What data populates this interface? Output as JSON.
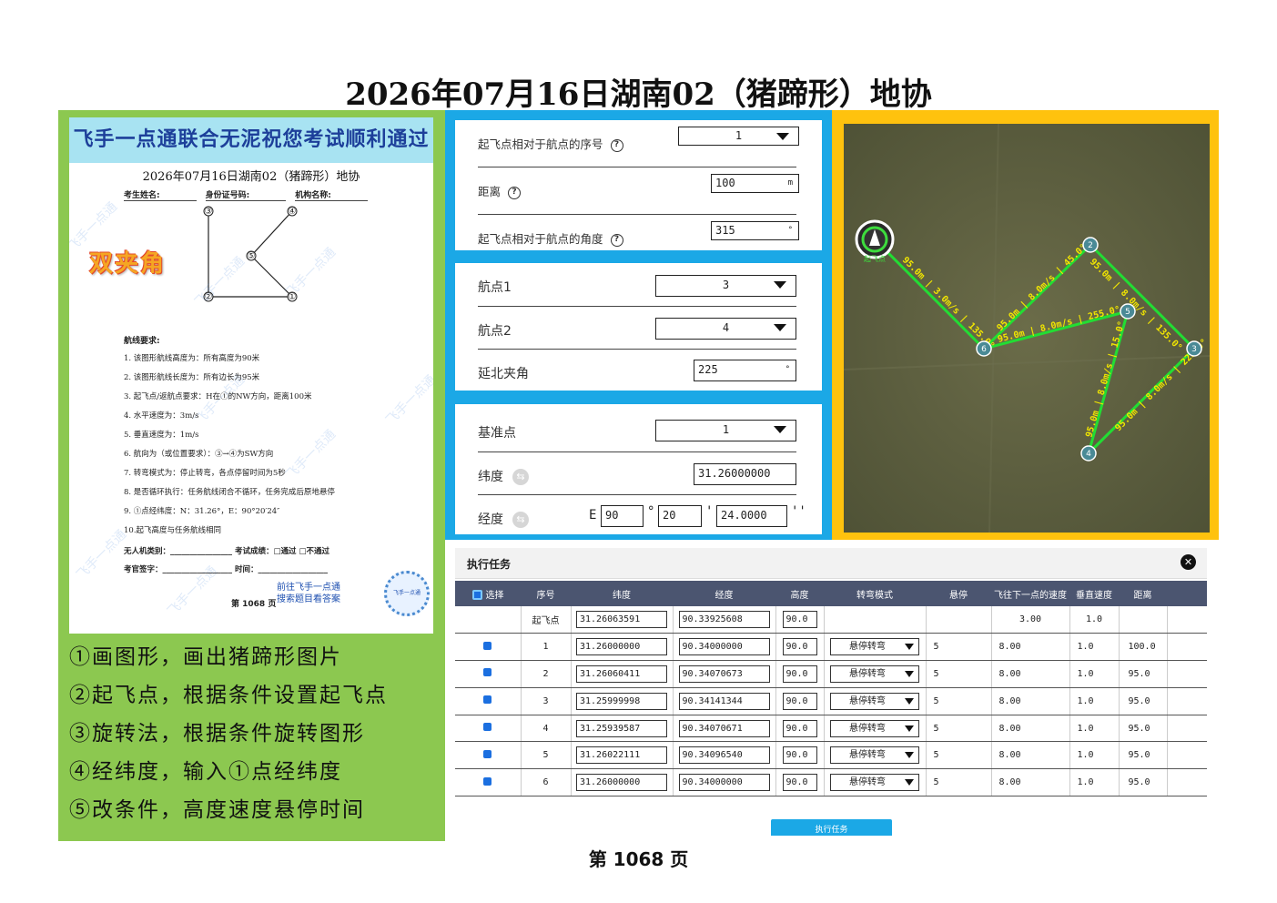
{
  "page_title": "2026年07月16日湖南02（猪蹄形）地协",
  "exam_sheet": {
    "banner": "飞手一点通联合无泥祝您考试顺利通过",
    "title": "2026年07月16日湖南02（猪蹄形）地协",
    "fields": [
      "考生姓名:",
      "身份证号码:",
      "机构名称:"
    ],
    "big_label": "双夹角",
    "watermark": "飞手一点通",
    "waypoint_labels": [
      "③",
      "④",
      "⑤",
      "②",
      "①"
    ],
    "requirements_title": "航线要求:",
    "requirements": [
      "1. 该图形航线高度为：所有高度为90米",
      "2. 该图形航线长度为：所有边长为95米",
      "3. 起飞点/返航点要求：H在①的NW方向，距离100米",
      "4. 水平速度为：3m/s",
      "5. 垂直速度为：1m/s",
      "6. 航向为（或位置要求）：③→④为SW方向",
      "7. 转弯模式为：停止转弯，各点停留时间为5秒",
      "8. 是否循环执行：任务航线闭合不循环，任务完成后原地悬停",
      "9. ①点经纬度：N：31.26°，E：90°20′24″",
      "10.起飞高度与任务航线相同"
    ],
    "bottom_lines": [
      "无人机类别：________________ 考试成绩：□通过  □不通过",
      "考官签字：__________________ 时间：__________________"
    ],
    "promo_lines": [
      "前往飞手一点通",
      "搜索题目看答案"
    ],
    "page_label": "第 1068 页",
    "qr_label": "飞手一点通"
  },
  "steps": [
    "①画图形，画出猪蹄形图片",
    "②起飞点，根据条件设置起飞点",
    "③旋转法，根据条件旋转图形",
    "④经纬度，输入①点经纬度",
    "⑤改条件，高度速度悬停时间"
  ],
  "takeoff_form": {
    "seq_label": "起飞点相对于航点的序号",
    "seq_value": "1",
    "distance_label": "距离",
    "distance_value": "100",
    "distance_unit": "m",
    "angle_label": "起飞点相对于航点的角度",
    "angle_value": "315",
    "angle_unit": "°"
  },
  "rotate_form": {
    "wp1_label": "航点1",
    "wp1_value": "3",
    "wp2_label": "航点2",
    "wp2_value": "4",
    "north_angle_label": "延北夹角",
    "north_angle_value": "225",
    "north_angle_unit": "°"
  },
  "coord_form": {
    "ref_label": "基准点",
    "ref_value": "1",
    "lat_label": "纬度",
    "lat_value": "31.26000000",
    "lon_label": "经度",
    "lon_prefix": "E",
    "lon_deg": "90",
    "lon_min": "20",
    "lon_sec": "24.0000",
    "deg_mark": "°",
    "min_mark": "'",
    "sec_mark": "''"
  },
  "map": {
    "home_label": "起飞点",
    "waypoints": [
      "1",
      "2",
      "3",
      "4",
      "5",
      "6"
    ],
    "leg_labels": [
      "95.0m | 8.0m/s | 45.0°",
      "95.0m | 8.0m/s | 135.0°",
      "95.0m | 8.0m/s | 225.0°",
      "95.0m | 8.0m/s | 15.0°",
      "95.0m | 8.0m/s | 255.0°",
      "95.0m | 3.0m/s | 135.0°"
    ],
    "route_color": "#22dd33"
  },
  "task": {
    "title": "执行任务",
    "close_icon": "✕",
    "columns": [
      "选择",
      "序号",
      "纬度",
      "经度",
      "高度",
      "转弯模式",
      "悬停",
      "飞往下一点的速度",
      "垂直速度",
      "距离"
    ],
    "home_row": {
      "seq": "起飞点",
      "lat": "31.26063591",
      "lon": "90.33925608",
      "alt": "90.0",
      "speed": "3.00",
      "vspeed": "1.0"
    },
    "rows": [
      {
        "seq": "1",
        "lat": "31.26000000",
        "lon": "90.34000000",
        "alt": "90.0",
        "turn": "悬停转弯",
        "hover": "5",
        "speed": "8.00",
        "vspeed": "1.0",
        "dist": "100.0"
      },
      {
        "seq": "2",
        "lat": "31.26060411",
        "lon": "90.34070673",
        "alt": "90.0",
        "turn": "悬停转弯",
        "hover": "5",
        "speed": "8.00",
        "vspeed": "1.0",
        "dist": "95.0"
      },
      {
        "seq": "3",
        "lat": "31.25999998",
        "lon": "90.34141344",
        "alt": "90.0",
        "turn": "悬停转弯",
        "hover": "5",
        "speed": "8.00",
        "vspeed": "1.0",
        "dist": "95.0"
      },
      {
        "seq": "4",
        "lat": "31.25939587",
        "lon": "90.34070671",
        "alt": "90.0",
        "turn": "悬停转弯",
        "hover": "5",
        "speed": "8.00",
        "vspeed": "1.0",
        "dist": "95.0"
      },
      {
        "seq": "5",
        "lat": "31.26022111",
        "lon": "90.34096540",
        "alt": "90.0",
        "turn": "悬停转弯",
        "hover": "5",
        "speed": "8.00",
        "vspeed": "1.0",
        "dist": "95.0"
      },
      {
        "seq": "6",
        "lat": "31.26000000",
        "lon": "90.34000000",
        "alt": "90.0",
        "turn": "悬停转弯",
        "hover": "5",
        "speed": "8.00",
        "vspeed": "1.0",
        "dist": "95.0"
      }
    ],
    "execute_label": "执行任务"
  },
  "page_footer": "第 1068 页"
}
